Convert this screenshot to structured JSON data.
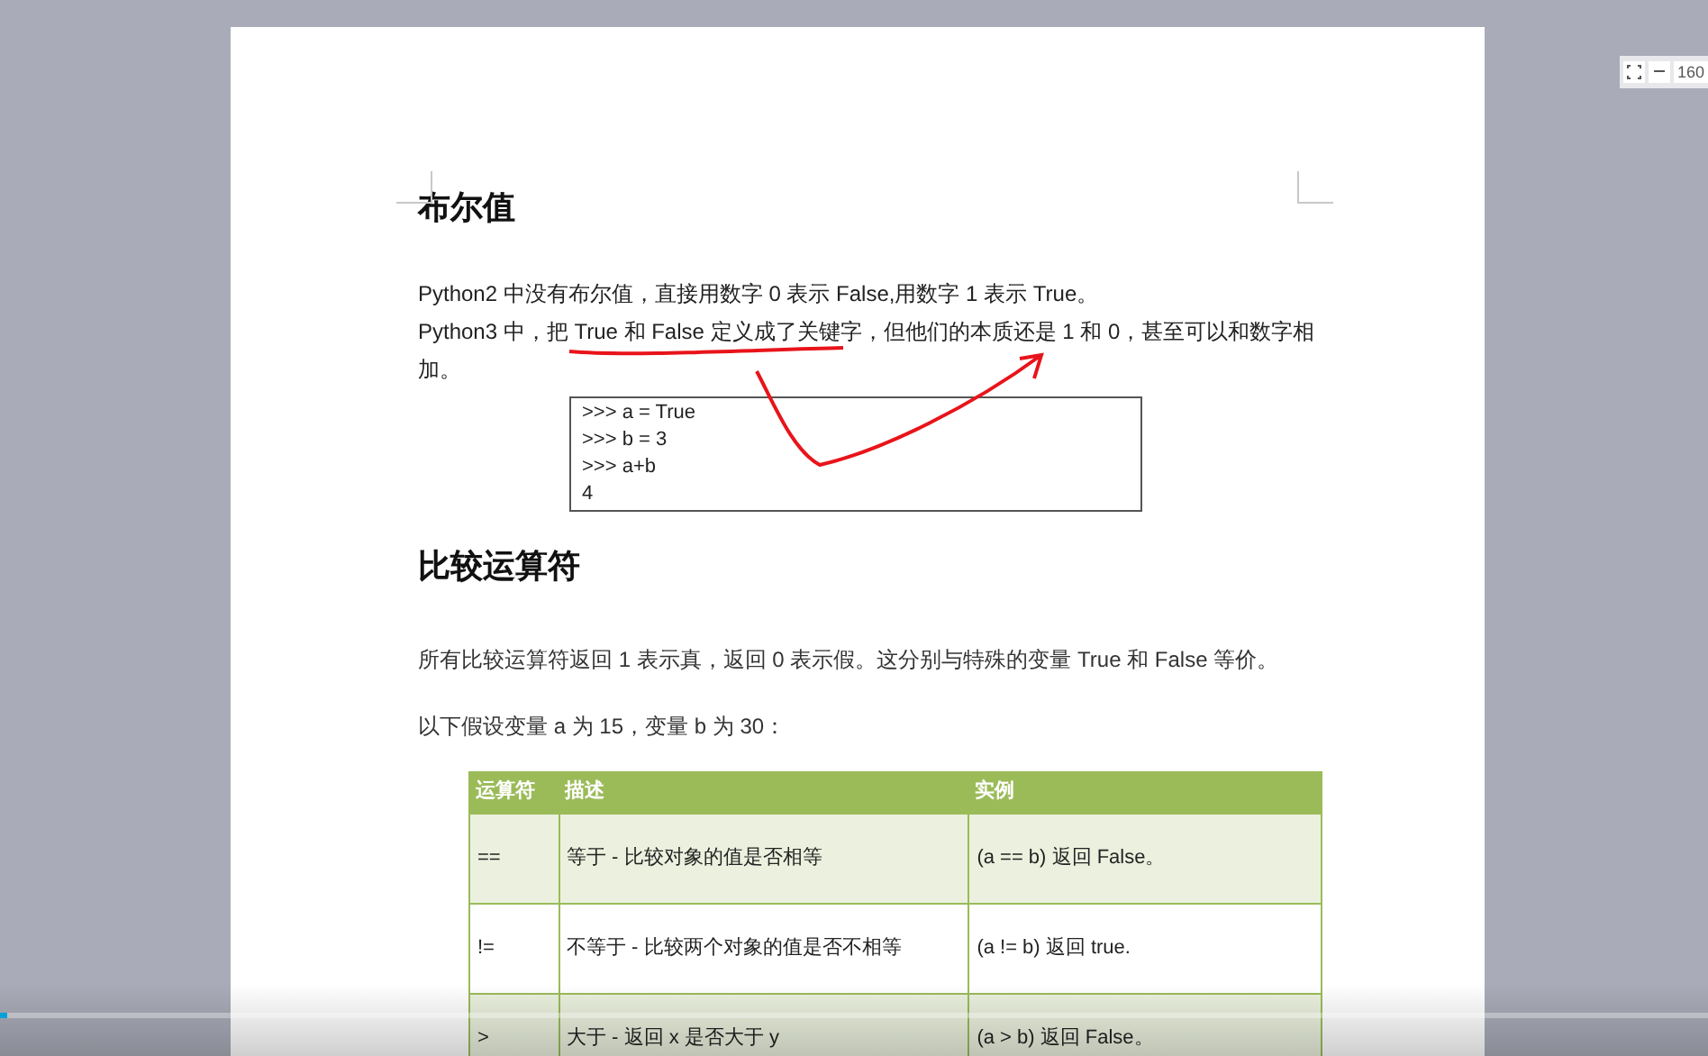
{
  "zoom_toolbar": {
    "reading": "160"
  },
  "document": {
    "sections": [
      {
        "heading": "布尔值",
        "paragraphs": [
          "Python2 中没有布尔值，直接用数字 0 表示 False,用数字 1 表示 True。",
          "Python3 中，把 True 和 False 定义成了关键字，但他们的本质还是 1 和 0，甚至可以和数字相加。"
        ],
        "code": [
          ">>> a = True",
          ">>> b = 3",
          ">>> a+b",
          "4"
        ]
      },
      {
        "heading": "比较运算符",
        "paragraphs": [
          "所有比较运算符返回 1 表示真，返回 0 表示假。这分别与特殊的变量 True 和 False 等价。",
          "以下假设变量 a 为 15，变量 b 为 30："
        ]
      }
    ],
    "table": {
      "columns": [
        "运算符",
        "描述",
        "实例"
      ],
      "rows": [
        [
          "==",
          "等于 - 比较对象的值是否相等",
          "(a == b) 返回 False。"
        ],
        [
          "!=",
          "不等于 - 比较两个对象的值是否不相等",
          "(a != b) 返回 true."
        ],
        [
          ">",
          "大于 - 返回 x 是否大于 y",
          "(a > b) 返回 False。"
        ]
      ]
    }
  },
  "video_progress": {
    "level": 0.004
  }
}
